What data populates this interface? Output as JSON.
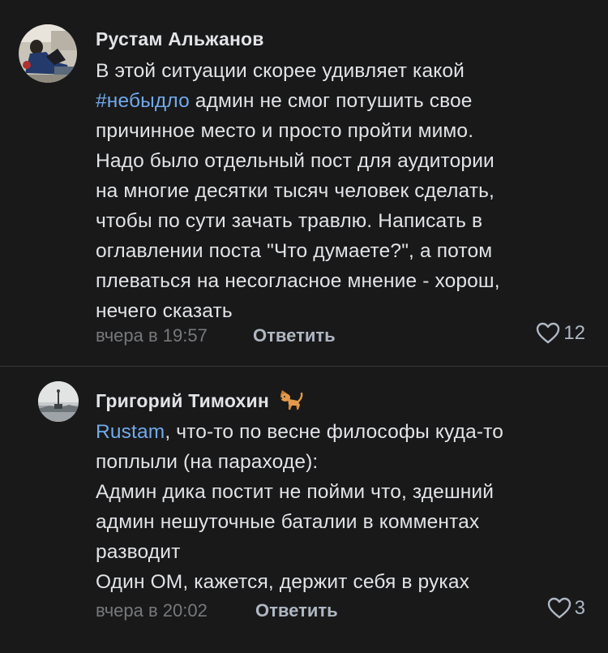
{
  "comments": [
    {
      "author": "Рустам Альжанов",
      "lines": [
        [
          "В этой ситуации скорее удивляет какой",
          ""
        ],
        [
          "#небыдло",
          " админ не смог потушить свое"
        ],
        [
          "причинное место и просто пройти мимо.",
          ""
        ],
        [
          "Надо было отдельный пост для аудитории",
          ""
        ],
        [
          "на многие десятки тысяч человек сделать,",
          ""
        ],
        [
          "чтобы по сути зачать травлю. Написать в",
          ""
        ],
        [
          "оглавлении поста \"Что думаете?\", а потом",
          ""
        ],
        [
          "плеваться на несогласное мнение - хорош,",
          ""
        ],
        [
          "нечего сказать",
          ""
        ]
      ],
      "line_1": "В этой ситуации скорее удивляет какой",
      "hashtag": "#небыдло",
      "line_2_rest": " админ не смог потушить свое",
      "line_3": "причинное место и просто пройти мимо.",
      "line_4": "Надо было отдельный пост для аудитории",
      "line_5": "на многие десятки тысяч человек сделать,",
      "line_6": "чтобы по сути зачать травлю. Написать в",
      "line_7": "оглавлении поста \"Что думаете?\", а потом",
      "line_8": "плеваться на несогласное мнение - хорош,",
      "line_9": "нечего сказать",
      "time": "вчера в 19:57",
      "reply_label": "Ответить",
      "likes": "12"
    },
    {
      "author": "Григорий Тимохин",
      "author_icon": "dog-emoji-icon",
      "mention": "Rustam",
      "line_1_rest": ", что-то по весне философы куда-то",
      "line_2": "поплыли (на параходе):",
      "line_3": "Админ дика постит не пойми что, здешний",
      "line_4": "админ нешуточные баталии в комментах",
      "line_5": "разводит",
      "line_6": "Один ОМ, кажется, держит себя в руках",
      "time": "вчера в 20:02",
      "reply_label": "Ответить",
      "likes": "3"
    }
  ],
  "colors": {
    "background": "#19191a",
    "text": "#e1e3e6",
    "link": "#71aaeb",
    "muted": "#76787a",
    "action": "#aeb7c2"
  }
}
